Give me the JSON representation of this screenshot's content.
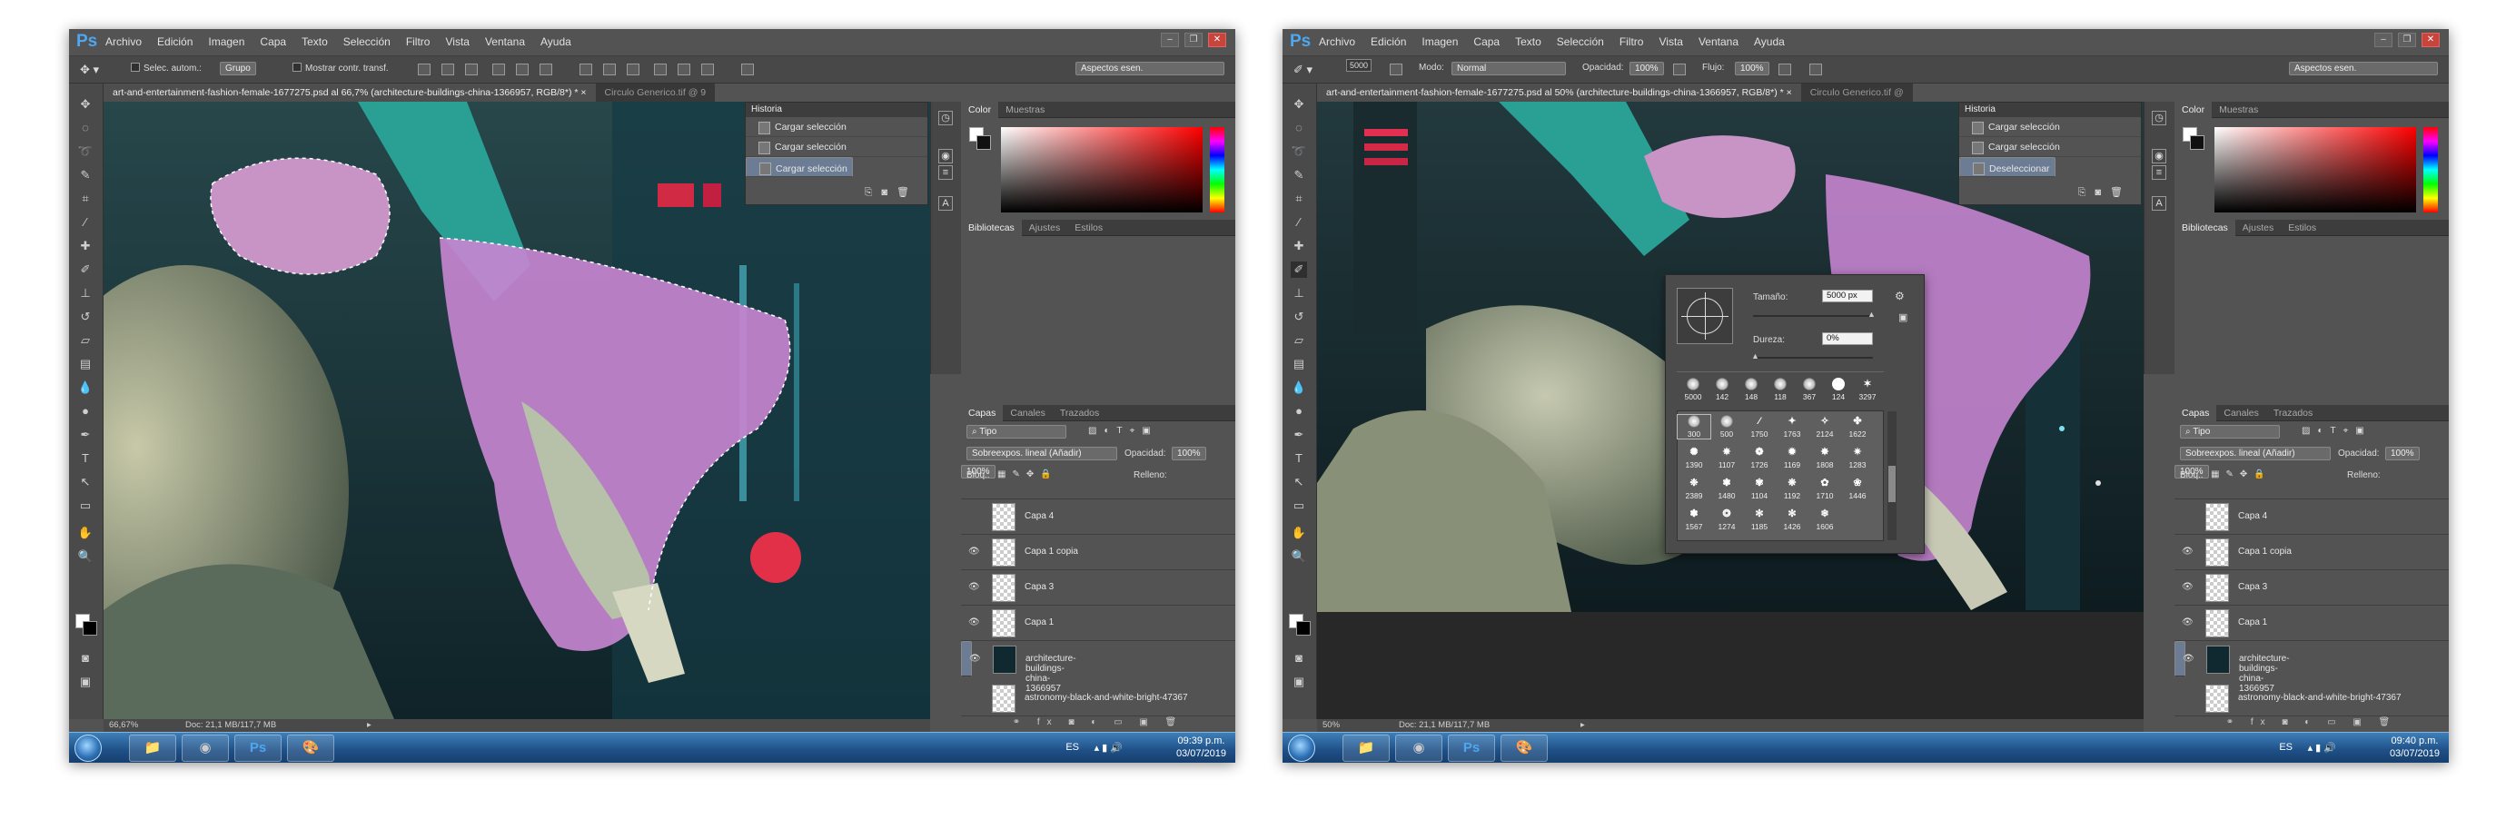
{
  "menu_items": [
    "Archivo",
    "Edición",
    "Imagen",
    "Capa",
    "Texto",
    "Selección",
    "Filtro",
    "Vista",
    "Ventana",
    "Ayuda"
  ],
  "win1": {
    "options": {
      "auto_select": "Selec. autom.:",
      "group": "Grupo",
      "show_transform": "Mostrar contr. transf.",
      "workspace": "Aspectos esen."
    },
    "tabs": [
      {
        "label": "art-and-entertainment-fashion-female-1677275.psd al 66,7% (architecture-buildings-china-1366957, RGB/8*) *",
        "close": "×"
      },
      {
        "label": "Circulo Generico.tif @ 9"
      }
    ],
    "history": {
      "title": "Historia",
      "items": [
        "Cargar selección",
        "Cargar selección",
        "Cargar selección"
      ]
    },
    "status": {
      "zoom": "66,67%",
      "doc": "Doc: 21,1 MB/117,7 MB"
    },
    "clock": {
      "time": "09:39 p.m.",
      "date": "03/07/2019"
    }
  },
  "win2": {
    "options": {
      "brush_size": "5000",
      "mode_label": "Modo:",
      "mode": "Normal",
      "opacity_label": "Opacidad:",
      "opacity": "100%",
      "flow_label": "Flujo:",
      "flow": "100%",
      "workspace": "Aspectos esen."
    },
    "tabs": [
      {
        "label": "art-and-entertainment-fashion-female-1677275.psd al 50% (architecture-buildings-china-1366957, RGB/8*) *",
        "close": "×"
      },
      {
        "label": "Circulo Generico.tif @"
      }
    ],
    "history": {
      "title": "Historia",
      "items": [
        "Cargar selección",
        "Cargar selección",
        "Deseleccionar"
      ]
    },
    "brush_popup": {
      "size_label": "Tamaño:",
      "size_value": "5000 px",
      "hardness_label": "Dureza:",
      "hardness_value": "0%",
      "top_presets": [
        "5000",
        "142",
        "148",
        "118",
        "367",
        "124",
        "3297"
      ],
      "presets_row1": [
        "300",
        "500",
        "1750",
        "1763",
        "2124",
        "1622"
      ],
      "presets_row2": [
        "1390",
        "1107",
        "1726",
        "1169",
        "1808",
        "1283"
      ],
      "presets_row3": [
        "2389",
        "1480",
        "1104",
        "1192",
        "1710",
        "1446"
      ],
      "presets_row4": [
        "1567",
        "1274",
        "1185",
        "1426",
        "1606"
      ]
    },
    "status": {
      "zoom": "50%",
      "doc": "Doc: 21,1 MB/117,7 MB"
    },
    "clock": {
      "time": "09:40 p.m.",
      "date": "03/07/2019"
    }
  },
  "color_panel": {
    "tab1": "Color",
    "tab2": "Muestras"
  },
  "lib_panel": {
    "tab1": "Bibliotecas",
    "tab2": "Ajustes",
    "tab3": "Estilos"
  },
  "layers_panel": {
    "tab1": "Capas",
    "tab2": "Canales",
    "tab3": "Trazados",
    "kind": "Tipo",
    "blend_mode": "Sobreexpos. lineal (Añadir)",
    "opacity_label": "Opacidad:",
    "opacity": "100%",
    "lock_label": "Bloq.:",
    "fill_label": "Relleno:",
    "fill": "100%",
    "layers": [
      {
        "name": "Capa 4",
        "visible": false
      },
      {
        "name": "Capa 1 copia",
        "visible": true
      },
      {
        "name": "Capa 3",
        "visible": true
      },
      {
        "name": "Capa 1",
        "visible": true
      },
      {
        "name": "architecture-buildings-china-1366957",
        "visible": true,
        "selected": true
      },
      {
        "name": "astronomy-black-and-white-bright-47367",
        "visible": false
      }
    ]
  },
  "tray": {
    "lang": "ES"
  },
  "colors": {
    "ui_bg": "#535353",
    "panel_dark": "#3d3d3d",
    "selected_row": "#6c7c94",
    "ps_blue": "#4ea7f0",
    "taskbar": "#1e4f86"
  }
}
